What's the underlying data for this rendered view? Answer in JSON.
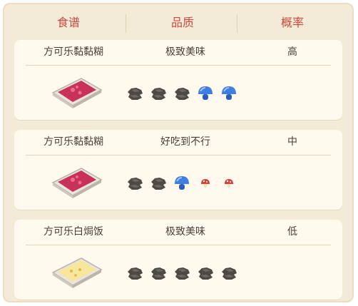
{
  "header": {
    "col_recipe": "食谱",
    "col_quality": "品质",
    "col_probability": "概率"
  },
  "recipes": [
    {
      "name": "方可乐黏黏糊",
      "quality": "极致美味",
      "probability": "高",
      "dish_color": "#c8325a",
      "ingredients": [
        "dark-stone-icon",
        "dark-stone-icon",
        "dark-stone-icon",
        "blue-mushroom-icon",
        "blue-mushroom-icon"
      ]
    },
    {
      "name": "方可乐黏黏糊",
      "quality": "好吃到不行",
      "probability": "中",
      "dish_color": "#c8325a",
      "ingredients": [
        "dark-stone-icon",
        "dark-stone-icon",
        "blue-mushroom-icon",
        "red-mushroom-icon",
        "red-mushroom-icon"
      ]
    },
    {
      "name": "方可乐白焗饭",
      "quality": "极致美味",
      "probability": "低",
      "dish_color": "#f6e79c",
      "ingredients": [
        "dark-stone-icon",
        "dark-stone-icon",
        "dark-stone-icon",
        "dark-stone-icon",
        "dark-stone-icon"
      ]
    }
  ],
  "colors": {
    "header_text": "#c84a3e",
    "panel_bg": "#f4ead8",
    "card_bg": "#fff9ee",
    "stone": "#4d4945",
    "blue_mushroom": "#3f7fe0",
    "red_mushroom": "#d8403a"
  }
}
